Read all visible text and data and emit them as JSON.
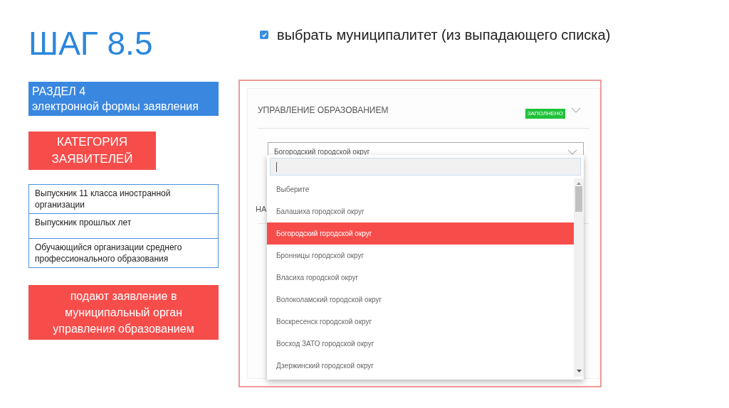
{
  "title": "ШАГ 8.5",
  "instruction": {
    "checked": true,
    "text": "выбрать муниципалитет (из выпадающего списка)"
  },
  "section_banner": {
    "line1": "РАЗДЕЛ 4",
    "line2": "электронной формы заявления"
  },
  "category_banner": [
    "КАТЕГОРИЯ",
    "ЗАЯВИТЕЛЕЙ"
  ],
  "applicant_categories": [
    "Выпускник 11 класса иностранной организации",
    "Выпускник прошлых лет",
    "Обучающийся организации среднего профессионального образования"
  ],
  "result_banner": [
    "подают заявление в",
    "муниципальный орган",
    "управления образованием"
  ],
  "form": {
    "section_title": "УПРАВЛЕНИЕ ОБРАЗОВАНИЕМ",
    "status": "ЗАПОЛНЕНО",
    "select_value": "Богородский городской округ",
    "next_section_title": "НА",
    "options": [
      {
        "label": "Выберите",
        "selected": false
      },
      {
        "label": "Балашиха городской округ",
        "selected": false
      },
      {
        "label": "Богородский городской округ",
        "selected": true
      },
      {
        "label": "Бронницы городской округ",
        "selected": false
      },
      {
        "label": "Власиха городской округ",
        "selected": false
      },
      {
        "label": "Волоколамский городской округ",
        "selected": false
      },
      {
        "label": "Воскресенск городской округ",
        "selected": false
      },
      {
        "label": "Восход ЗАТО городской округ",
        "selected": false
      },
      {
        "label": "Дзержинский городской округ",
        "selected": false
      }
    ]
  }
}
